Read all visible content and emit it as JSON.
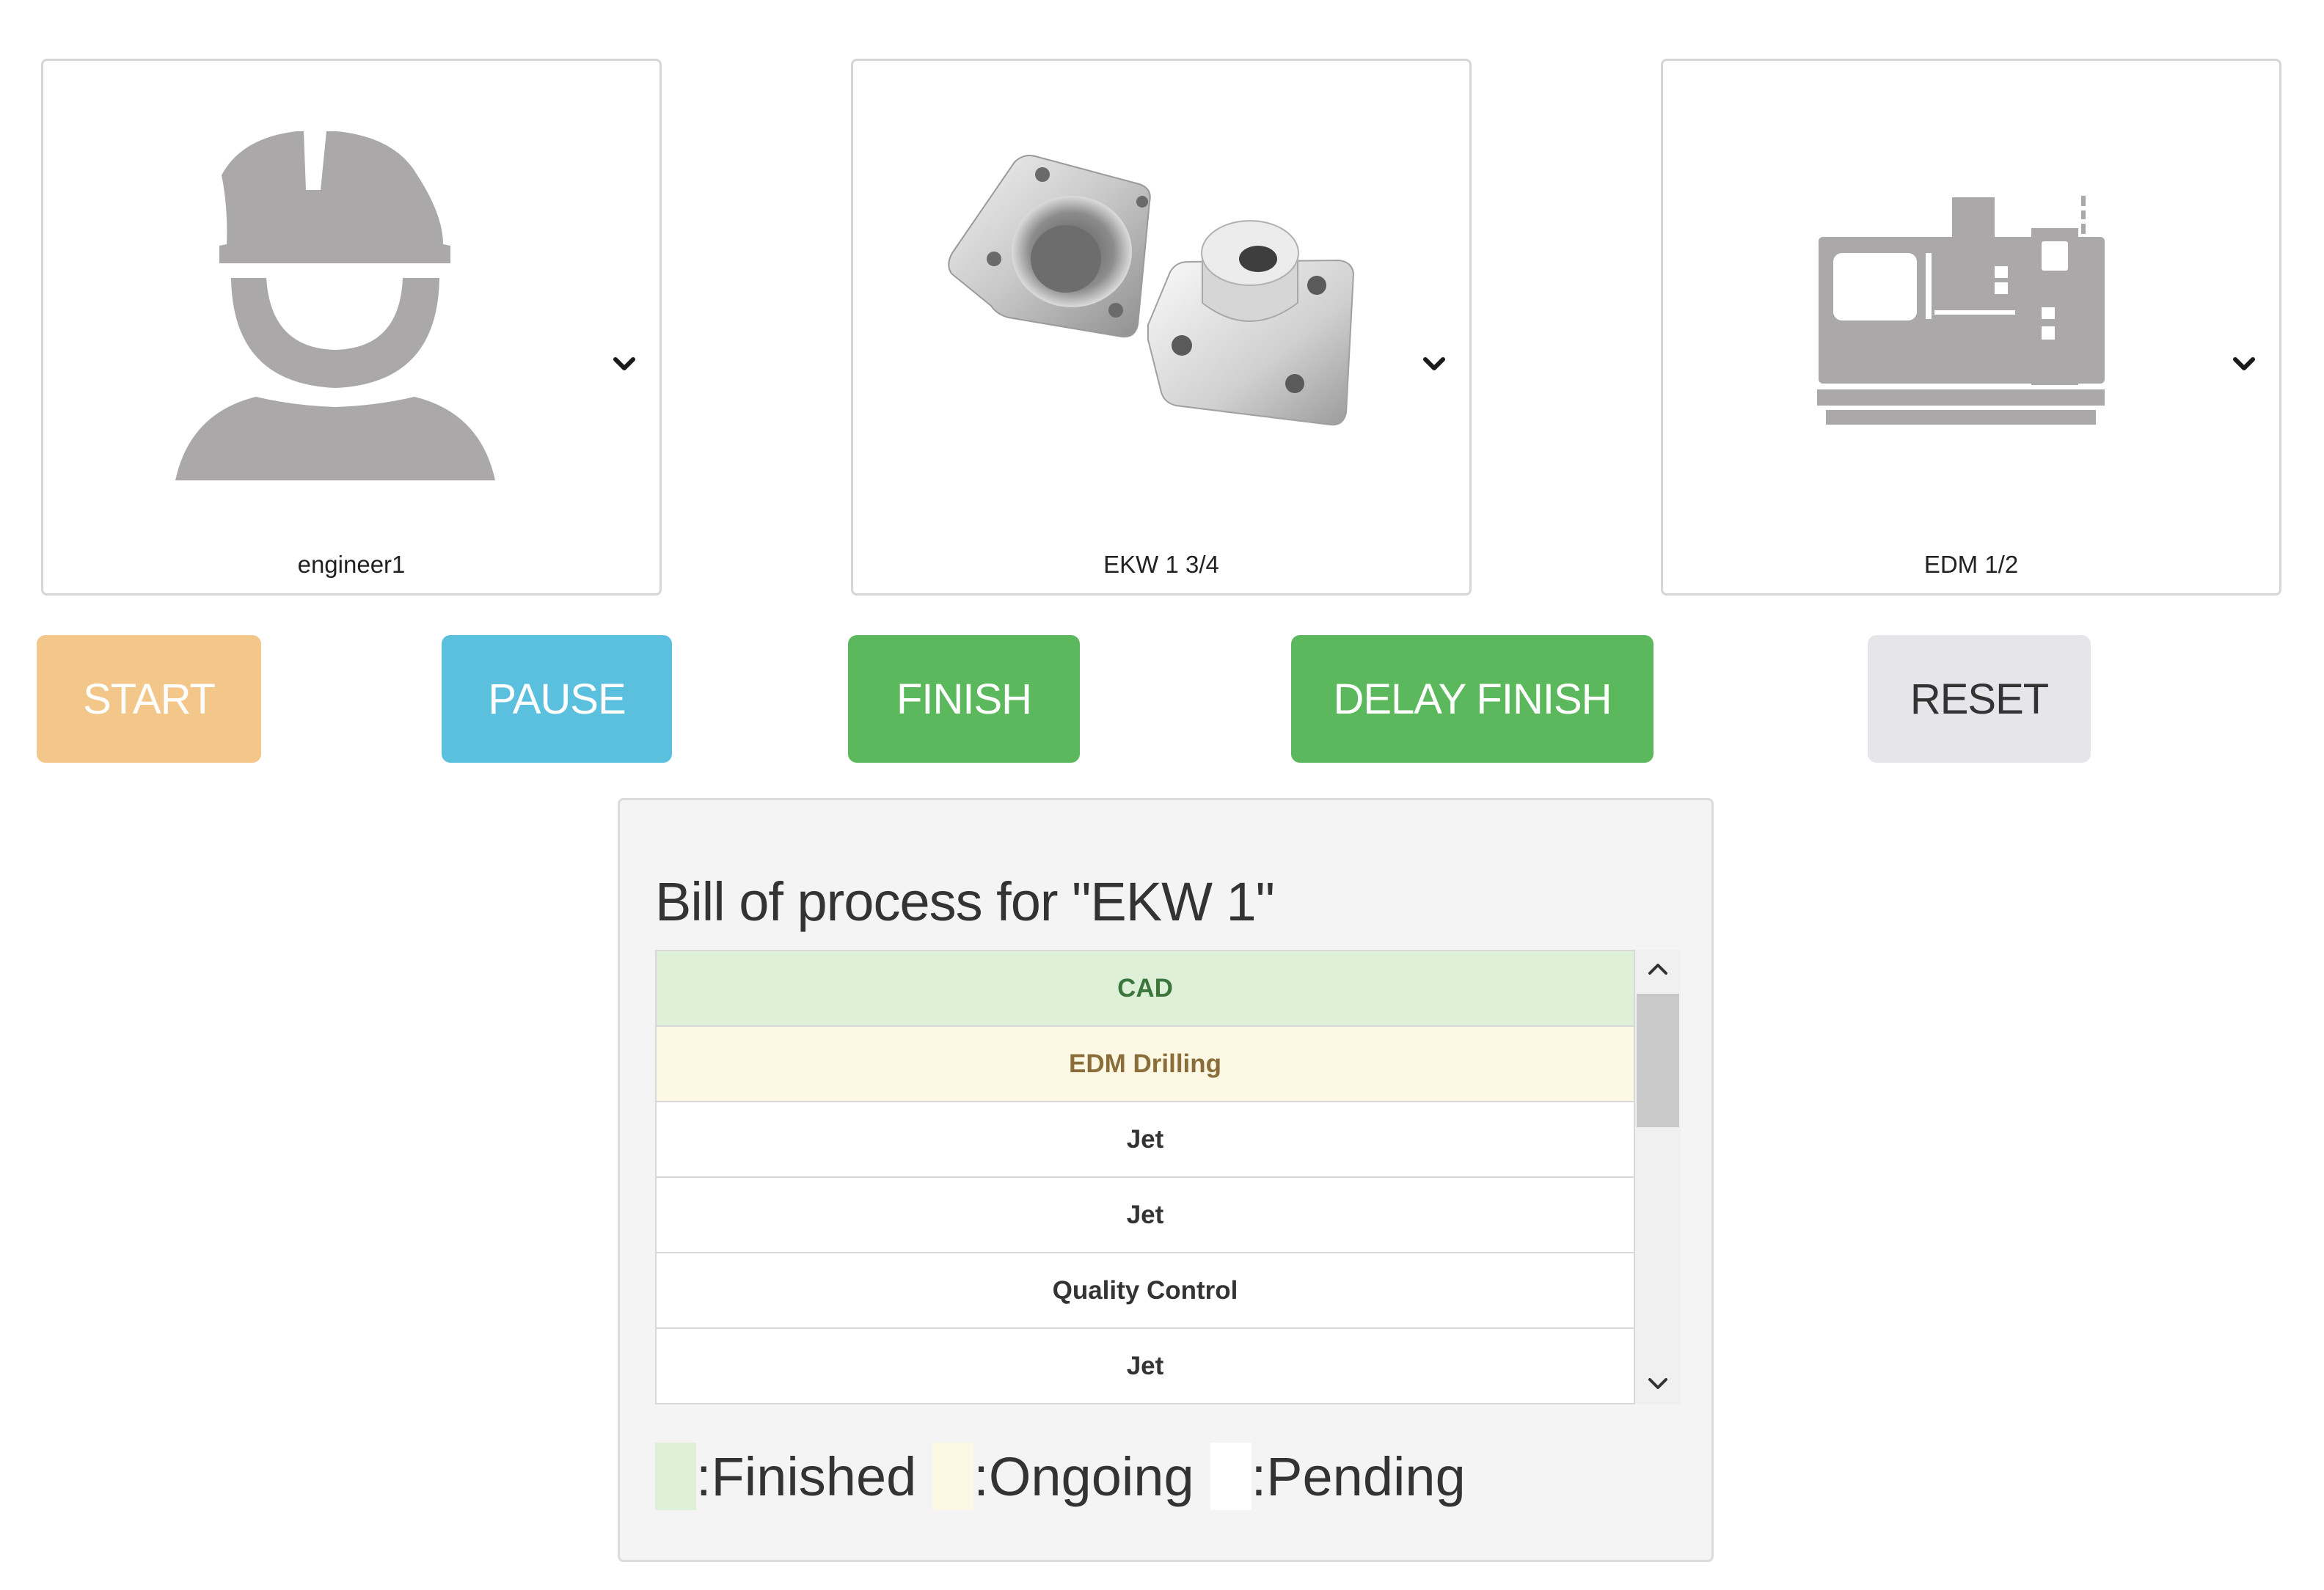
{
  "cards": {
    "engineer": {
      "caption": "engineer1",
      "icon": "engineer-hardhat-icon"
    },
    "part": {
      "caption": "EKW 1 3/4",
      "icon": "metal-flange-part-image"
    },
    "machine": {
      "caption": "EDM 1/2",
      "icon": "cnc-machine-icon"
    }
  },
  "buttons": {
    "start": "START",
    "pause": "PAUSE",
    "finish": "FINISH",
    "delay_finish": "DELAY FINISH",
    "reset": "RESET"
  },
  "colors": {
    "start": "#f3c78a",
    "pause": "#5bc0de",
    "finish": "#5cb85c",
    "reset": "#e6e6ea",
    "finished": "#dff0d8",
    "ongoing": "#fcf8e3",
    "pending": "#ffffff",
    "icon_gray": "#aaa8a8"
  },
  "bill": {
    "title": "Bill of process for \"EKW 1\"",
    "steps": [
      {
        "label": "CAD",
        "status": "finished"
      },
      {
        "label": "EDM Drilling",
        "status": "ongoing"
      },
      {
        "label": "Jet",
        "status": "pending"
      },
      {
        "label": "Jet",
        "status": "pending"
      },
      {
        "label": "Quality Control",
        "status": "pending"
      },
      {
        "label": "Jet",
        "status": "pending"
      }
    ]
  },
  "legend": {
    "finished": ":Finished",
    "ongoing": ":Ongoing",
    "pending": ":Pending"
  }
}
